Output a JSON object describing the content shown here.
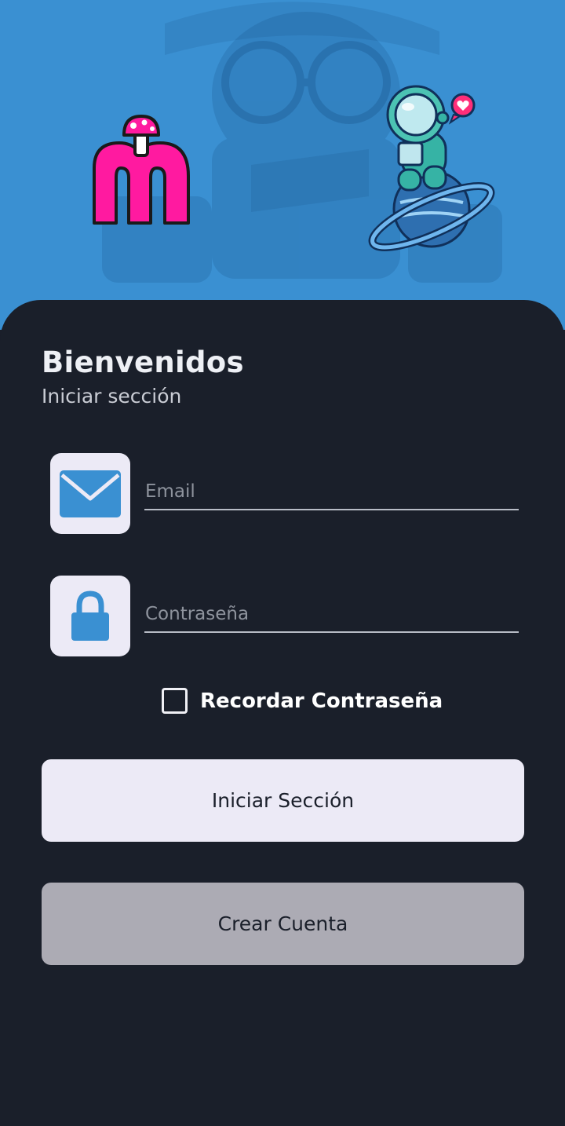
{
  "header": {
    "logo_icon": "m-mushroom-logo",
    "mascot_icon": "astronaut-on-planet"
  },
  "welcome": {
    "title": "Bienvenidos",
    "subtitle": "Iniciar sección"
  },
  "form": {
    "email": {
      "icon": "envelope-icon",
      "placeholder": "Email",
      "value": ""
    },
    "password": {
      "icon": "lock-icon",
      "placeholder": "Contraseña",
      "value": ""
    },
    "remember": {
      "label": "Recordar Contraseña",
      "checked": false
    }
  },
  "actions": {
    "login_label": "Iniciar Sección",
    "create_label": "Crear Cuenta"
  },
  "colors": {
    "hero_blue": "#3a90d2",
    "panel_dark": "#1a1f2a",
    "field_icon_bg": "#eceaf6",
    "icon_blue": "#3a90d2",
    "logo_pink": "#ff1aa0",
    "button_primary": "#eceaf6",
    "button_secondary": "#acabb4"
  }
}
